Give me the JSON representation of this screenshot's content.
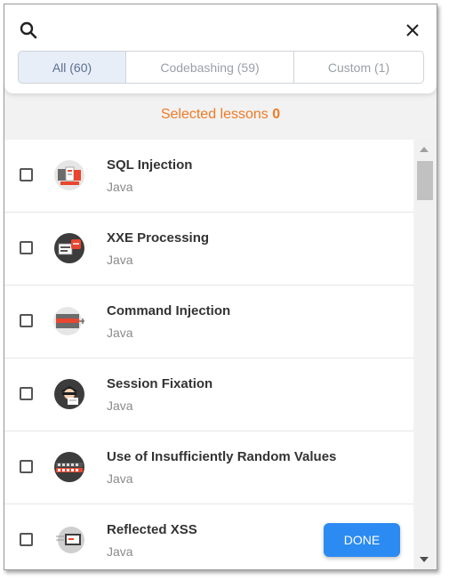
{
  "tabs": [
    {
      "label": "All (60)"
    },
    {
      "label": "Codebashing (59)"
    },
    {
      "label": "Custom (1)"
    }
  ],
  "selected": {
    "label": "Selected lessons",
    "count": "0"
  },
  "lessons": [
    {
      "title": "SQL Injection",
      "language": "Java",
      "icon": "sql-injection-icon"
    },
    {
      "title": "XXE Processing",
      "language": "Java",
      "icon": "xxe-processing-icon"
    },
    {
      "title": "Command Injection",
      "language": "Java",
      "icon": "command-injection-icon"
    },
    {
      "title": "Session Fixation",
      "language": "Java",
      "icon": "session-fixation-icon"
    },
    {
      "title": "Use of Insufficiently Random Values",
      "language": "Java",
      "icon": "random-values-icon"
    },
    {
      "title": "Reflected XSS",
      "language": "Java",
      "icon": "reflected-xss-icon"
    }
  ],
  "done_label": "DONE",
  "colors": {
    "accent": "#ef7b24",
    "primary": "#2b8bf2",
    "tab_active_bg": "#e8eef8"
  }
}
